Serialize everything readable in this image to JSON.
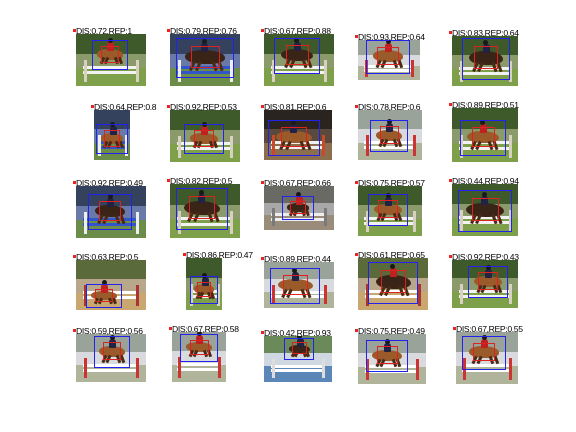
{
  "thumbnails": [
    {
      "label": "DIS:0.72,REP:1",
      "palette": "green",
      "dark": false
    },
    {
      "label": "DIS:0.79,REP:0.76",
      "palette": "blue",
      "dark": true
    },
    {
      "label": "DIS:0.67,REP:0.88",
      "palette": "green",
      "dark": true
    },
    {
      "label": "DIS:0.93,REP:0.64",
      "palette": "white",
      "dark": false
    },
    {
      "label": "DIS:0.83,REP:0.64",
      "palette": "green",
      "dark": true
    },
    {
      "label": "DIS:0.64,REP:0.8",
      "palette": "blue",
      "dark": false
    },
    {
      "label": "DIS:0.92,REP:0.53",
      "palette": "green",
      "dark": false
    },
    {
      "label": "DIS:0.81,REP:0.6",
      "palette": "dark",
      "dark": false
    },
    {
      "label": "DIS:0.78,REP:0.6",
      "palette": "white",
      "dark": false
    },
    {
      "label": "DIS:0.89,REP:0.51",
      "palette": "green",
      "dark": false
    },
    {
      "label": "DIS:0.92,REP:0.49",
      "palette": "blue",
      "dark": true
    },
    {
      "label": "DIS:0.82,REP:0.5",
      "palette": "green",
      "dark": true
    },
    {
      "label": "DIS:0.67,REP:0.66",
      "palette": "grey",
      "dark": true
    },
    {
      "label": "DIS:0.75,REP:0.57",
      "palette": "green",
      "dark": false
    },
    {
      "label": "DIS:0.44,REP:0.94",
      "palette": "green",
      "dark": true
    },
    {
      "label": "DIS:0.63,REP:0.5",
      "palette": "sand",
      "dark": false
    },
    {
      "label": "DIS:0.86,REP:0.47",
      "palette": "green",
      "dark": false
    },
    {
      "label": "DIS:0.89,REP:0.44",
      "palette": "white",
      "dark": false
    },
    {
      "label": "DIS:0.61,REP:0.65",
      "palette": "sand",
      "dark": true
    },
    {
      "label": "DIS:0.92,REP:0.43",
      "palette": "green",
      "dark": false
    },
    {
      "label": "DIS:0.59,REP:0.56",
      "palette": "white",
      "dark": false
    },
    {
      "label": "DIS:0.67,REP:0.58",
      "palette": "white",
      "dark": false
    },
    {
      "label": "DIS:0.42,REP:0.93",
      "palette": "water",
      "dark": true
    },
    {
      "label": "DIS:0.75,REP:0.49",
      "palette": "white",
      "dark": false
    },
    {
      "label": "DIS:0.67,REP:0.55",
      "palette": "white",
      "dark": false
    }
  ],
  "colors": {
    "box": "#2222ee",
    "marker": "#dd2222",
    "label": "#000000"
  }
}
